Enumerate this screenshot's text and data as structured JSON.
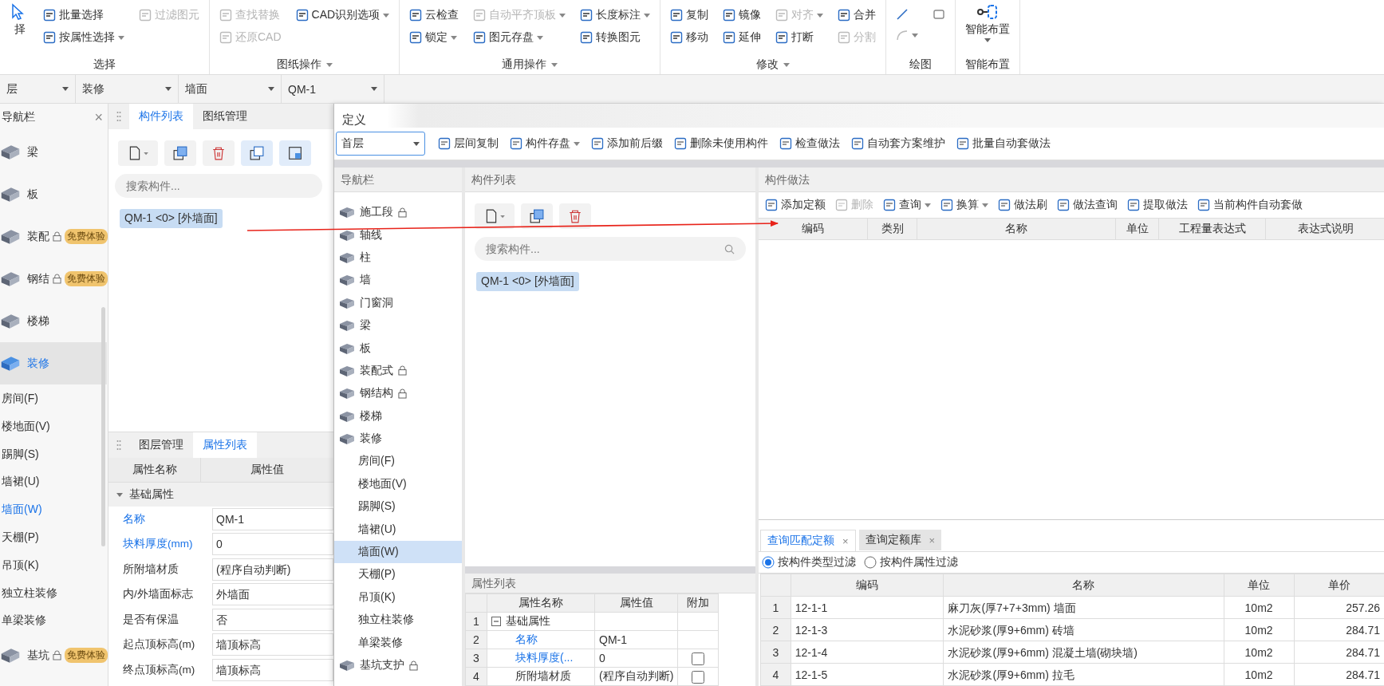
{
  "ribbon": {
    "groups": [
      {
        "label": "选择",
        "menu": false,
        "large": {
          "kind": "select",
          "label": "择",
          "menu": false
        },
        "rows": [
          [
            {
              "kind": "tool",
              "label": "批量选择",
              "disabled": false,
              "menu": false
            },
            {
              "kind": "tool",
              "label": "过滤图元",
              "disabled": true,
              "menu": false
            }
          ],
          [
            {
              "kind": "tool",
              "label": "按属性选择",
              "disabled": false,
              "menu": true
            }
          ]
        ]
      },
      {
        "label": "图纸操作",
        "menu": true,
        "rows": [
          [
            {
              "kind": "tool",
              "label": "查找替换",
              "disabled": true,
              "menu": false
            },
            {
              "kind": "tool",
              "label": "CAD识别选项",
              "disabled": false,
              "menu": true
            }
          ],
          [
            {
              "kind": "tool",
              "label": "还原CAD",
              "disabled": true,
              "menu": false
            }
          ]
        ]
      },
      {
        "label": "通用操作",
        "menu": true,
        "rows": [
          [
            {
              "kind": "tool",
              "label": "云检查",
              "disabled": false,
              "menu": false
            },
            {
              "kind": "tool",
              "label": "自动平齐顶板",
              "disabled": true,
              "menu": true
            },
            {
              "kind": "tool",
              "label": "长度标注",
              "disabled": false,
              "menu": true
            }
          ],
          [
            {
              "kind": "tool",
              "label": "锁定",
              "disabled": false,
              "menu": true
            },
            {
              "kind": "tool",
              "label": "图元存盘",
              "disabled": false,
              "menu": true
            },
            {
              "kind": "tool",
              "label": "转换图元",
              "disabled": false,
              "menu": false
            }
          ]
        ]
      },
      {
        "label": "修改",
        "menu": true,
        "rows": [
          [
            {
              "kind": "tool",
              "label": "复制",
              "disabled": false,
              "menu": false
            },
            {
              "kind": "tool",
              "label": "镜像",
              "disabled": false,
              "menu": false
            },
            {
              "kind": "tool",
              "label": "对齐",
              "disabled": true,
              "menu": true
            },
            {
              "kind": "tool",
              "label": "合并",
              "disabled": false,
              "menu": false
            }
          ],
          [
            {
              "kind": "tool",
              "label": "移动",
              "disabled": false,
              "menu": false
            },
            {
              "kind": "tool",
              "label": "延伸",
              "disabled": false,
              "menu": false
            },
            {
              "kind": "tool",
              "label": "打断",
              "disabled": false,
              "menu": false
            },
            {
              "kind": "tool",
              "label": "分割",
              "disabled": true,
              "menu": false
            }
          ]
        ]
      },
      {
        "label": "绘图",
        "menu": false,
        "rows": [
          [
            {
              "kind": "line",
              "disabled": false,
              "menu": false
            },
            {
              "kind": "rect",
              "disabled": false,
              "menu": false
            }
          ],
          [
            {
              "kind": "arc",
              "disabled": true,
              "menu": true
            }
          ]
        ]
      },
      {
        "label": "智能布置",
        "menu": false,
        "large": {
          "kind": "layout",
          "label": "智能布置",
          "menu": true
        }
      }
    ]
  },
  "floor_bar": [
    {
      "value": "层"
    },
    {
      "value": "装修"
    },
    {
      "value": "墙面"
    },
    {
      "value": "QM-1"
    }
  ],
  "left_nav": {
    "title": "导航栏",
    "close": "×",
    "items": [
      {
        "label": "梁",
        "selected": false,
        "locked": false
      },
      {
        "label": "板",
        "selected": false,
        "locked": false
      },
      {
        "label": "装配",
        "selected": false,
        "locked": true,
        "badge": "免费体验"
      },
      {
        "label": "钢结",
        "selected": false,
        "locked": true,
        "badge": "免费体验"
      },
      {
        "label": "楼梯",
        "selected": false,
        "locked": false
      },
      {
        "label": "装修",
        "selected": true,
        "locked": false,
        "children": [
          {
            "label": "房间(F)",
            "selected": false
          },
          {
            "label": "楼地面(V)",
            "selected": false
          },
          {
            "label": "踢脚(S)",
            "selected": false
          },
          {
            "label": "墙裙(U)",
            "selected": false
          },
          {
            "label": "墙面(W)",
            "selected": true
          },
          {
            "label": "天棚(P)",
            "selected": false
          },
          {
            "label": "吊顶(K)",
            "selected": false
          },
          {
            "label": "独立柱装修",
            "selected": false
          },
          {
            "label": "单梁装修",
            "selected": false
          }
        ]
      },
      {
        "label": "基坑",
        "selected": false,
        "locked": true,
        "badge": "免费体验"
      }
    ]
  },
  "component_panel": {
    "tabs": [
      {
        "label": "构件列表",
        "selected": true
      },
      {
        "label": "图纸管理",
        "selected": false
      }
    ],
    "search": {
      "placeholder": "搜索构件..."
    },
    "items": [
      {
        "label": "QM-1 <0> [外墙面]",
        "selected": true
      }
    ]
  },
  "property_panel": {
    "tabs": [
      {
        "label": "图层管理",
        "selected": false
      },
      {
        "label": "属性列表",
        "selected": true
      }
    ],
    "columns": [
      "属性名称",
      "属性值"
    ],
    "group": {
      "label": "基础属性",
      "expanded": true
    },
    "rows": [
      {
        "name": "名称",
        "value": "QM-1",
        "kind": "public"
      },
      {
        "name": "块料厚度(mm)",
        "value": "0",
        "kind": "public"
      },
      {
        "name": "所附墙材质",
        "value": "(程序自动判断)",
        "kind": "private"
      },
      {
        "name": "内/外墙面标志",
        "value": "外墙面",
        "kind": "private"
      },
      {
        "name": "是否有保温",
        "value": "否",
        "kind": "private"
      },
      {
        "name": "起点顶标高(m)",
        "value": "墙顶标高",
        "kind": "private"
      },
      {
        "name": "终点顶标高(m)",
        "value": "墙顶标高",
        "kind": "private"
      }
    ]
  },
  "dialog": {
    "title": "定义",
    "floor": {
      "value": "首层"
    },
    "toolbar": [
      {
        "label": "层间复制",
        "menu": false
      },
      {
        "label": "构件存盘",
        "menu": true
      },
      {
        "label": "添加前后缀",
        "menu": false
      },
      {
        "label": "删除未使用构件",
        "menu": false
      },
      {
        "label": "检查做法",
        "menu": false
      },
      {
        "label": "自动套方案维护",
        "menu": false
      },
      {
        "label": "批量自动套做法",
        "menu": false
      }
    ],
    "nav": {
      "title": "导航栏",
      "items": [
        {
          "label": "施工段",
          "locked": true,
          "selected": false
        },
        {
          "label": "轴线",
          "locked": false,
          "selected": false
        },
        {
          "label": "柱",
          "locked": false,
          "selected": false
        },
        {
          "label": "墙",
          "locked": false,
          "selected": false
        },
        {
          "label": "门窗洞",
          "locked": false,
          "selected": false
        },
        {
          "label": "梁",
          "locked": false,
          "selected": false
        },
        {
          "label": "板",
          "locked": false,
          "selected": false
        },
        {
          "label": "装配式",
          "locked": true,
          "selected": false
        },
        {
          "label": "钢结构",
          "locked": true,
          "selected": false
        },
        {
          "label": "楼梯",
          "locked": false,
          "selected": false
        },
        {
          "label": "装修",
          "locked": false,
          "selected": false,
          "children": [
            {
              "label": "房间(F)",
              "selected": false
            },
            {
              "label": "楼地面(V)",
              "selected": false
            },
            {
              "label": "踢脚(S)",
              "selected": false
            },
            {
              "label": "墙裙(U)",
              "selected": false
            },
            {
              "label": "墙面(W)",
              "selected": true
            },
            {
              "label": "天棚(P)",
              "selected": false
            },
            {
              "label": "吊顶(K)",
              "selected": false
            },
            {
              "label": "独立柱装修",
              "selected": false
            },
            {
              "label": "单梁装修",
              "selected": false
            }
          ]
        },
        {
          "label": "基坑支护",
          "locked": true,
          "selected": false
        }
      ]
    },
    "component_list": {
      "title": "构件列表",
      "search": {
        "placeholder": "搜索构件..."
      },
      "items": [
        {
          "label": "QM-1 <0> [外墙面]",
          "selected": true
        }
      ]
    },
    "properties": {
      "title": "属性列表",
      "columns": [
        "属性名称",
        "属性值",
        "附加"
      ],
      "rows": [
        {
          "index": "1",
          "kind": "group",
          "name": "基础属性",
          "expanded": true
        },
        {
          "index": "2",
          "kind": "public",
          "name": "名称",
          "value": "QM-1"
        },
        {
          "index": "3",
          "kind": "public",
          "name": "块料厚度(...",
          "value": "0",
          "extra": false
        },
        {
          "index": "4",
          "kind": "private",
          "name": "所附墙材质",
          "value": "(程序自动判断)",
          "extra": false
        }
      ]
    },
    "method": {
      "title": "构件做法",
      "toolbar": [
        {
          "label": "添加定额",
          "disabled": false,
          "menu": false
        },
        {
          "label": "删除",
          "disabled": true,
          "menu": false
        },
        {
          "label": "查询",
          "disabled": false,
          "menu": true
        },
        {
          "label": "换算",
          "disabled": false,
          "menu": true
        },
        {
          "label": "做法刷",
          "disabled": false,
          "menu": false
        },
        {
          "label": "做法查询",
          "disabled": false,
          "menu": false
        },
        {
          "label": "提取做法",
          "disabled": false,
          "menu": false
        },
        {
          "label": "当前构件自动套做",
          "disabled": false,
          "menu": false
        }
      ],
      "columns": [
        "编码",
        "类别",
        "名称",
        "单位",
        "工程量表达式",
        "表达式说明"
      ]
    },
    "query": {
      "tabs": [
        {
          "label": "查询匹配定额",
          "close": "×",
          "selected": true
        },
        {
          "label": "查询定额库",
          "close": "×",
          "selected": false
        }
      ],
      "filters": [
        {
          "label": "按构件类型过滤",
          "selected": true
        },
        {
          "label": "按构件属性过滤",
          "selected": false
        }
      ],
      "columns": [
        "编码",
        "名称",
        "单位",
        "单价"
      ],
      "rows": [
        {
          "index": "1",
          "code": "12-1-1",
          "name": "麻刀灰(厚7+7+3mm) 墙面",
          "unit": "10m2",
          "price": "257.26"
        },
        {
          "index": "2",
          "code": "12-1-3",
          "name": "水泥砂浆(厚9+6mm) 砖墙",
          "unit": "10m2",
          "price": "284.71"
        },
        {
          "index": "3",
          "code": "12-1-4",
          "name": "水泥砂浆(厚9+6mm) 混凝土墙(砌块墙)",
          "unit": "10m2",
          "price": "284.71"
        },
        {
          "index": "4",
          "code": "12-1-5",
          "name": "水泥砂浆(厚9+6mm) 拉毛",
          "unit": "10m2",
          "price": "284.71"
        }
      ]
    }
  }
}
